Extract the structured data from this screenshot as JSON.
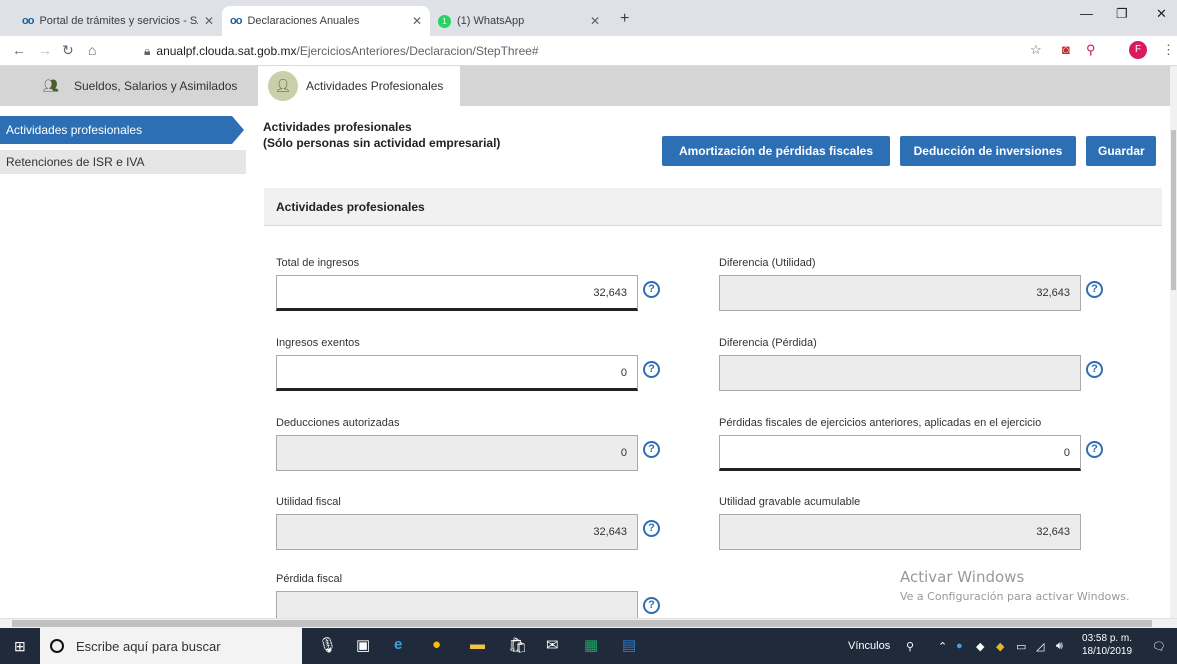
{
  "browser": {
    "tabs": [
      {
        "title": "Portal de trámites y servicios - SAT",
        "active": false
      },
      {
        "title": "Declaraciones Anuales",
        "active": true
      },
      {
        "title": "(1) WhatsApp",
        "active": false
      }
    ],
    "wa_badge": "1",
    "url_host": "anualpf.clouda.sat.gob.mx",
    "url_path": "/EjerciciosAnteriores/Declaracion/StepThree#",
    "profile_initial": "F"
  },
  "top_nav": {
    "item1": "Sueldos, Salarios y Asimilados",
    "item2": "Actividades Profesionales"
  },
  "sidebar": {
    "items": [
      {
        "label": "Actividades profesionales"
      },
      {
        "label": "Retenciones de ISR e IVA"
      }
    ]
  },
  "main": {
    "title_line1": "Actividades profesionales",
    "title_line2": "(Sólo personas sin actividad empresarial)",
    "buttons": {
      "amortizacion": "Amortización de pérdidas fiscales",
      "deduccion": "Deducción de inversiones",
      "guardar": "Guardar"
    },
    "panel_title": "Actividades profesionales",
    "fields": {
      "total_ingresos": {
        "label": "Total de ingresos",
        "value": "32,643"
      },
      "ingresos_exentos": {
        "label": "Ingresos exentos",
        "value": "0"
      },
      "deducciones": {
        "label": "Deducciones autorizadas",
        "value": "0"
      },
      "utilidad_fiscal": {
        "label": "Utilidad fiscal",
        "value": "32,643"
      },
      "perdida_fiscal": {
        "label": "Pérdida fiscal",
        "value": ""
      },
      "diferencia_utilidad": {
        "label": "Diferencia (Utilidad)",
        "value": "32,643"
      },
      "diferencia_perdida": {
        "label": "Diferencia (Pérdida)",
        "value": ""
      },
      "perdidas_anteriores": {
        "label": "Pérdidas fiscales de ejercicios anteriores, aplicadas en el ejercicio",
        "value": "0"
      },
      "utilidad_gravable": {
        "label": "Utilidad gravable acumulable",
        "value": "32,643"
      }
    },
    "help_glyph": "?"
  },
  "watermark": {
    "line1": "Activar Windows",
    "line2": "Ve a Configuración para activar Windows."
  },
  "taskbar": {
    "search_placeholder": "Escribe aquí para buscar",
    "links_label": "Vínculos",
    "time": "03:58 p. m.",
    "date": "18/10/2019"
  }
}
